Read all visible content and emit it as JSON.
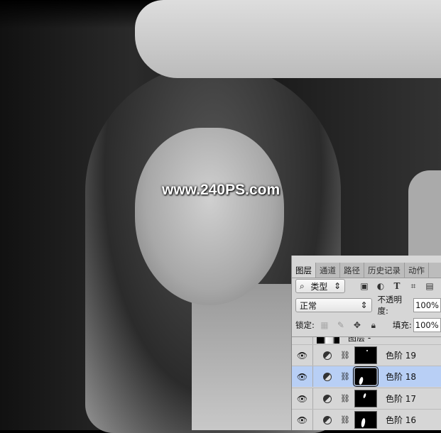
{
  "watermark": "www.240PS.com",
  "panel": {
    "tabs": [
      "图层",
      "通道",
      "路径",
      "历史记录",
      "动作"
    ],
    "filter_kind": "类型",
    "blend_mode": "正常",
    "opacity_label": "不透明度:",
    "opacity_value": "100%",
    "lock_label": "锁定:",
    "fill_label": "填充:",
    "fill_value": "100%",
    "partial_layer_name": "图层 -",
    "layers": [
      {
        "name": "色阶 19",
        "selected": false
      },
      {
        "name": "色阶 18",
        "selected": true
      },
      {
        "name": "色阶 17",
        "selected": false
      },
      {
        "name": "色阶 16",
        "selected": false
      }
    ],
    "selection_color": "#b8cff5"
  }
}
